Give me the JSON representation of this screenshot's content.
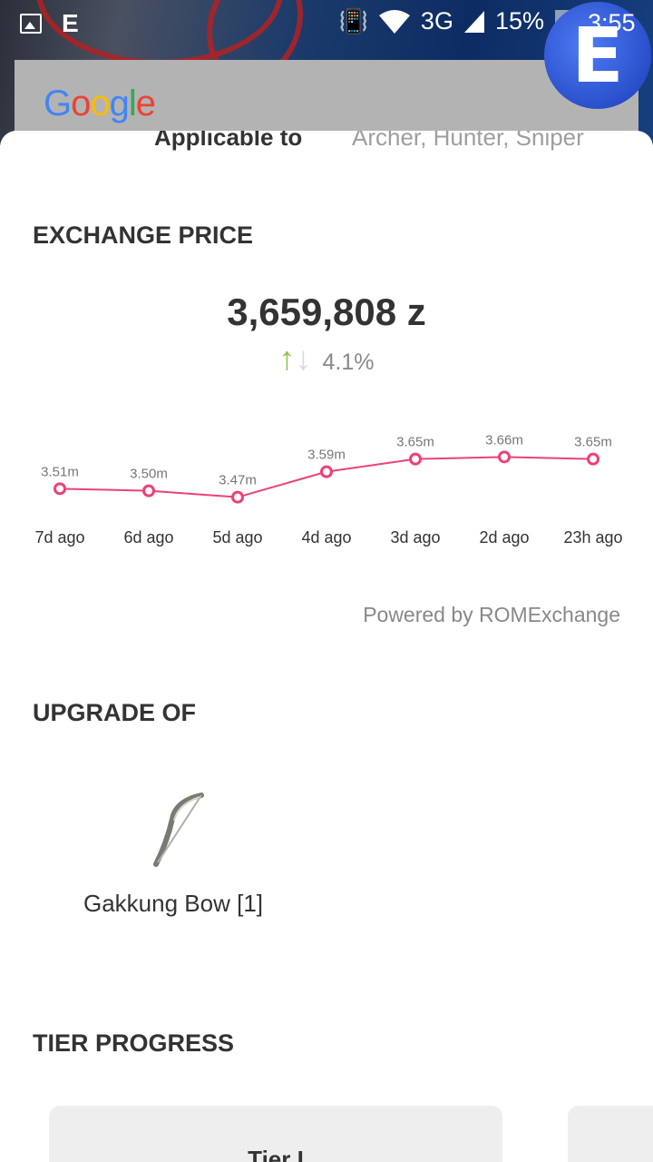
{
  "status_bar": {
    "carrier_icon_letter": "E",
    "network": "3G",
    "battery": "15%",
    "time": "3:55",
    "floating_bubble_letter": "E"
  },
  "search_bar": {
    "logo": "Google"
  },
  "item_detail": {
    "applicable_label": "Applicable to",
    "applicable_value": "Archer, Hunter, Sniper"
  },
  "exchange": {
    "title": "EXCHANGE PRICE",
    "price": "3,659,808 z",
    "change": "4.1%",
    "powered_by": "Powered by ROMExchange"
  },
  "chart_data": {
    "type": "line",
    "categories": [
      "7d ago",
      "6d ago",
      "5d ago",
      "4d ago",
      "3d ago",
      "2d ago",
      "23h ago"
    ],
    "values": [
      3.51,
      3.5,
      3.47,
      3.59,
      3.65,
      3.66,
      3.65
    ],
    "value_labels": [
      "3.51m",
      "3.50m",
      "3.47m",
      "3.59m",
      "3.65m",
      "3.66m",
      "3.65m"
    ],
    "color": "#ec407a"
  },
  "upgrade": {
    "title": "UPGRADE OF",
    "item_name": "Gakkung Bow [1]"
  },
  "tier": {
    "title": "TIER PROGRESS",
    "card_label": "Tier I"
  },
  "colors": {
    "accent": "#ec407a",
    "up": "#8bc34a"
  }
}
